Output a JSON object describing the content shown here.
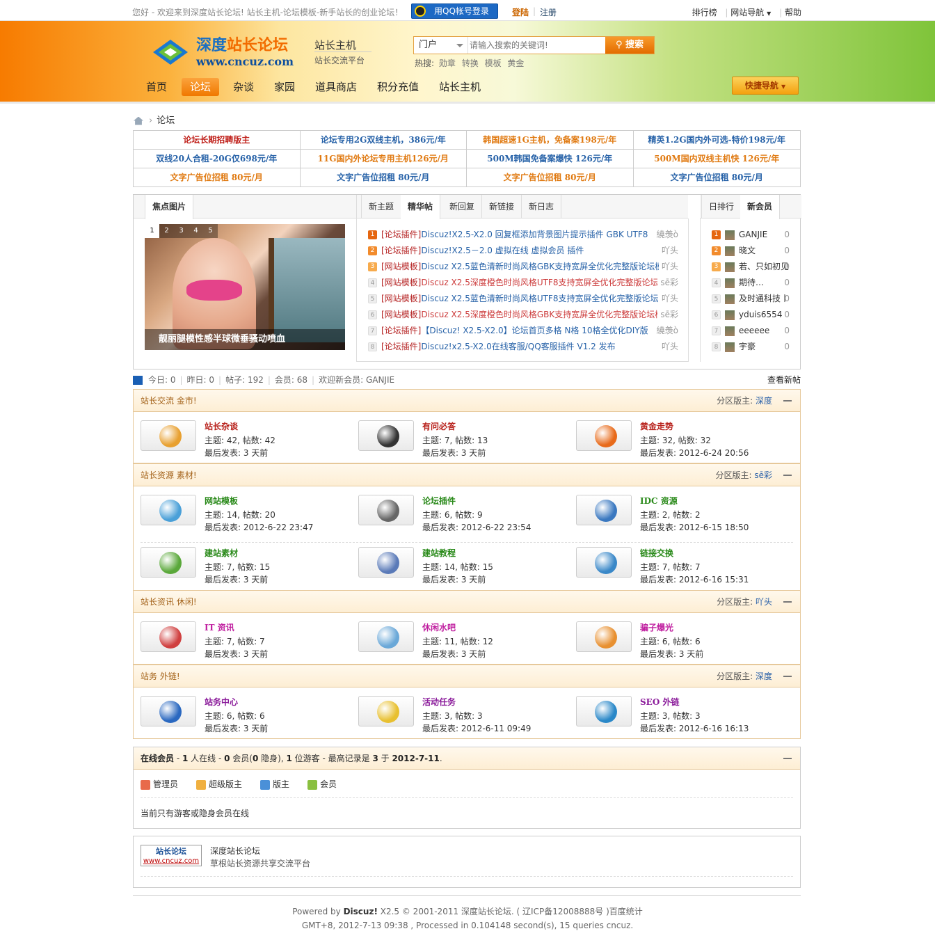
{
  "topbar": {
    "welcome": "您好 - 欢迎来到深度站长论坛! 站长主机-论坛模板-新手站长的创业论坛！",
    "qq_login": "用QQ帐号登录",
    "login": "登陆",
    "register": "注册",
    "links": [
      "排行榜",
      "网站导航",
      "帮助"
    ]
  },
  "header": {
    "logo_cn_a": "深度",
    "logo_cn_b": "站长论坛",
    "logo_url": "www.cncuz.com",
    "slogan_title": "站长主机",
    "slogan_sub": "站长交流平台",
    "search": {
      "scope": "门户",
      "placeholder": "请输入搜索的关键词!",
      "button": "搜索",
      "hot_label": "热搜:",
      "hot_words": [
        "勋章",
        "转换",
        "模板",
        "黄金"
      ]
    },
    "nav": [
      "首页",
      "论坛",
      "杂谈",
      "家园",
      "道具商店",
      "积分充值",
      "站长主机"
    ],
    "nav_active": "论坛",
    "quick_nav": "快捷导航"
  },
  "breadcrumb": "论坛",
  "ads": [
    {
      "text": "论坛长期招聘版主",
      "color": "#c0221c"
    },
    {
      "text": "论坛专用2G双线主机，386元/年",
      "color": "#2762a8"
    },
    {
      "text": "韩国超速1G主机，免备案198元/年",
      "color": "#e07a12"
    },
    {
      "text": "精英1.2G国内外可选-特价198元/年",
      "color": "#2762a8"
    },
    {
      "text": "双线20人合租-20G仅698元/年",
      "color": "#2762a8"
    },
    {
      "text": "11G国内外论坛专用主机126元/月",
      "color": "#e07a12"
    },
    {
      "text": "500M韩国免备案爆快 126元/年",
      "color": "#2762a8"
    },
    {
      "text": "500M国内双线主机快 126元/年",
      "color": "#e07a12"
    },
    {
      "text": "文字广告位招租 80元/月",
      "color": "#e07a12"
    },
    {
      "text": "文字广告位招租 80元/月",
      "color": "#2762a8"
    },
    {
      "text": "文字广告位招租 80元/月",
      "color": "#e07a12"
    },
    {
      "text": "文字广告位招租 80元/月",
      "color": "#2762a8"
    }
  ],
  "portal": {
    "focus_tab": "焦点图片",
    "pic_numbers": [
      "1",
      "2",
      "3",
      "4",
      "5"
    ],
    "pic_caption": "靓丽腿模性感半球微垂骚动喷血",
    "thread_tabs": [
      "新主题",
      "精华帖",
      "新回复",
      "新链接",
      "新日志"
    ],
    "thread_tab_active": "精华帖",
    "threads": [
      {
        "n": "1",
        "cat": "[论坛插件]",
        "title": "Discuz!X2.5-X2.0 回复框添加背景图片提示插件 GBK UTF8",
        "author": "繞羡ò",
        "red": false
      },
      {
        "n": "2",
        "cat": "[论坛插件]",
        "title": "Discuz!X2.5－2.0 虚拟在线 虚拟会员 插件",
        "author": "吖头",
        "red": false
      },
      {
        "n": "3",
        "cat": "[网站模板]",
        "title": "Discuz X2.5蓝色清新时尚风格GBK支持宽屏全优化完整版论坛模",
        "author": "吖头",
        "red": false
      },
      {
        "n": "4",
        "cat": "[网站模板]",
        "title": "Discuz X2.5深度橙色时尚风格UTF8支持宽屏全优化完整版论坛",
        "author": "sē彩",
        "red": true
      },
      {
        "n": "5",
        "cat": "[网站模板]",
        "title": "Discuz X2.5蓝色清新时尚风格UTF8支持宽屏全优化完整版论坛",
        "author": "吖头",
        "red": false
      },
      {
        "n": "6",
        "cat": "[网站模板]",
        "title": "Discuz X2.5深度橙色时尚风格GBK支持宽屏全优化完整版论坛模",
        "author": "sē彩",
        "red": true
      },
      {
        "n": "7",
        "cat": "[论坛插件]",
        "title": "【Discuz! X2.5-X2.0】论坛首页多格 N格 10格全优化DIY版",
        "author": "繞羡ò",
        "red": false
      },
      {
        "n": "8",
        "cat": "[论坛插件]",
        "title": "Discuz!x2.5-X2.0在线客服/QQ客服插件 V1.2 发布",
        "author": "吖头",
        "red": false
      }
    ],
    "member_tabs": [
      "日排行",
      "新会员"
    ],
    "member_tab_active": "新会员",
    "members": [
      {
        "n": "1",
        "name": "GANJIE",
        "count": "0"
      },
      {
        "n": "2",
        "name": "晓文",
        "count": "0"
      },
      {
        "n": "3",
        "name": "若、只如初见",
        "count": "0"
      },
      {
        "n": "4",
        "name": "期待…",
        "count": "0"
      },
      {
        "n": "5",
        "name": "及时通科技丨",
        "count": "0"
      },
      {
        "n": "6",
        "name": "yduis6554",
        "count": "0"
      },
      {
        "n": "7",
        "name": "eeeeee",
        "count": "0"
      },
      {
        "n": "8",
        "name": "宇豪",
        "count": "0"
      }
    ]
  },
  "stats": {
    "today": "今日: 0",
    "yesterday": "昨日: 0",
    "posts": "帖子: 192",
    "members": "会员: 68",
    "newest": "欢迎新会员: GANJIE",
    "new_posts_link": "查看新帖"
  },
  "sections": [
    {
      "title": "站长交流 金市!",
      "mod_label": "分区版主: ",
      "mod": "深度",
      "rows": [
        [
          {
            "name": "站长杂谈",
            "color": "#b8221c",
            "stat": "主题: 42, 帖数: 42",
            "last": "最后发表: 3 天前",
            "icon": "chat-bubbles-icon",
            "g": "#e8a030"
          },
          {
            "name": "有问必答",
            "color": "#b8221c",
            "stat": "主题: 7, 帖数: 13",
            "last": "最后发表: 3 天前",
            "icon": "question-icon",
            "g": "#333"
          },
          {
            "name": "黄金走势",
            "color": "#b8221c",
            "stat": "主题: 32, 帖数: 32",
            "last": "最后发表: 2012-6-24 20:56",
            "icon": "gold-egg-icon",
            "g": "#e86a1a"
          }
        ]
      ]
    },
    {
      "title": "站长资源 素材!",
      "mod_label": "分区版主: ",
      "mod": "sē彩",
      "rows": [
        [
          {
            "name": "网站模板",
            "color": "#2a8a1a",
            "stat": "主题: 14, 帖数: 20",
            "last": "最后发表: 2012-6-22 23:47",
            "icon": "monitor-icon",
            "g": "#4aa0d8"
          },
          {
            "name": "论坛插件",
            "color": "#2a8a1a",
            "stat": "主题: 6, 帖数: 9",
            "last": "最后发表: 2012-6-22 23:54",
            "icon": "tools-icon",
            "g": "#666"
          },
          {
            "name": "IDC 资源",
            "color": "#2a8a1a",
            "stat": "主题: 2, 帖数: 2",
            "last": "最后发表: 2012-6-15 18:50",
            "icon": "server-icon",
            "g": "#3a78c0"
          }
        ],
        [
          {
            "name": "建站素材",
            "color": "#2a8a1a",
            "stat": "主题: 7, 帖数: 15",
            "last": "最后发表: 3 天前",
            "icon": "tree-icon",
            "g": "#5aa83a"
          },
          {
            "name": "建站教程",
            "color": "#2a8a1a",
            "stat": "主题: 14, 帖数: 15",
            "last": "最后发表: 3 天前",
            "icon": "notebook-icon",
            "g": "#5a7ab8"
          },
          {
            "name": "链接交换",
            "color": "#2a8a1a",
            "stat": "主题: 7, 帖数: 7",
            "last": "最后发表: 2012-6-16 15:31",
            "icon": "magnifier-icon",
            "g": "#3a88c8"
          }
        ]
      ]
    },
    {
      "title": "站长资讯 休闲!",
      "mod_label": "分区版主: ",
      "mod": "吖头",
      "rows": [
        [
          {
            "name": "IT 资讯",
            "color": "#c020a0",
            "stat": "主题: 7, 帖数: 7",
            "last": "最后发表: 3 天前",
            "icon": "users-icon",
            "g": "#d04040"
          },
          {
            "name": "休闲水吧",
            "color": "#c020a0",
            "stat": "主题: 11, 帖数: 12",
            "last": "最后发表: 3 天前",
            "icon": "cloud-chat-icon",
            "g": "#6aa8d8"
          },
          {
            "name": "骗子爆光",
            "color": "#c020a0",
            "stat": "主题: 6, 帖数: 6",
            "last": "最后发表: 3 天前",
            "icon": "document-user-icon",
            "g": "#e89030"
          }
        ]
      ]
    },
    {
      "title": "站务 外链!",
      "mod_label": "分区版主: ",
      "mod": "深度",
      "rows": [
        [
          {
            "name": "站务中心",
            "color": "#8a1a9a",
            "stat": "主题: 6, 帖数: 6",
            "last": "最后发表: 3 天前",
            "icon": "windows-icon",
            "g": "#2a68c0"
          },
          {
            "name": "活动任务",
            "color": "#8a1a9a",
            "stat": "主题: 3, 帖数: 3",
            "last": "最后发表: 2012-6-11 09:49",
            "icon": "smiley-chat-icon",
            "g": "#e8c030"
          },
          {
            "name": "SEO 外链",
            "color": "#8a1a9a",
            "stat": "主题: 3, 帖数: 3",
            "last": "最后发表: 2012-6-16 16:13",
            "icon": "pulse-icon",
            "g": "#2a88c8"
          }
        ]
      ]
    }
  ],
  "online": {
    "label": "在线会员",
    "summary_pre": " - ",
    "count": "1",
    "summary": " 人在线 - ",
    "members_count": "0",
    "summary2": " 会员(",
    "hidden": "0",
    "summary3": " 隐身), ",
    "guests": "1",
    "summary4": " 位游客 - 最高记录是 ",
    "record": "3",
    "summary5": " 于 ",
    "record_date": "2012-7-11",
    "summary6": ".",
    "legend": [
      {
        "label": "管理员",
        "color": "#e86a4a"
      },
      {
        "label": "超级版主",
        "color": "#f0b040"
      },
      {
        "label": "版主",
        "color": "#4a90d8"
      },
      {
        "label": "会员",
        "color": "#8ac040"
      }
    ],
    "message": "当前只有游客或隐身会员在线"
  },
  "links": {
    "logo_text": "站长论坛",
    "logo_url": "www.cncuz.com",
    "title": "深度站长论坛",
    "desc": "草根站长资源共享交流平台"
  },
  "footer": {
    "powered": "Powered by ",
    "discuz": "Discuz!",
    "rest": " X2.5 © 2001-2011 深度站长论坛. ( 辽ICP备12008888号 )百度统计",
    "line2": "GMT+8, 2012-7-13 09:38 , Processed in 0.104148 second(s), 15 queries cncuz."
  }
}
